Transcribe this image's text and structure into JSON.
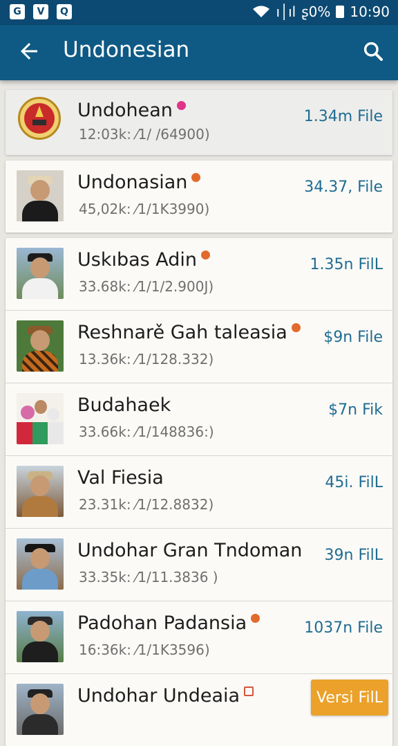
{
  "status_bar": {
    "left_icons": [
      "G",
      "V",
      "Q"
    ],
    "signal_text": "ı│ıl",
    "battery_text": "ʂ0%",
    "time": "10:90"
  },
  "app_bar": {
    "title": "Undonesian",
    "back_icon": "arrow-left-icon",
    "search_icon": "search-icon"
  },
  "items": [
    {
      "title": "Undohean",
      "subtitle": "12:03k: ⁄1/ /64900)",
      "size": "1.34m File",
      "badge": "pink"
    },
    {
      "title": "Undonasian",
      "subtitle": "45,02k: ⁄1/1K3990)",
      "size": "34.37, File",
      "badge": "orange"
    },
    {
      "title": "Uskıbas Adin",
      "subtitle": "33.68k: ⁄1/1/2.900J)",
      "size": "1.35n FilL",
      "badge": "orange"
    },
    {
      "title": "Reshnarě Gah taleasia",
      "subtitle": "13.36k: ⁄1/128.332)",
      "size": "$9n File",
      "badge": "orange"
    },
    {
      "title": "Budahaek",
      "subtitle": "33.66k: ⁄1/148836:)",
      "size": "$7n Fik",
      "badge": ""
    },
    {
      "title": "Val Fiesia",
      "subtitle": "23.31k: ⁄1/12.8832)",
      "size": "45i. FilL",
      "badge": ""
    },
    {
      "title": "Undohar Gran Tndoman",
      "subtitle": "33.35k: ⁄1/11.3836 )",
      "size": "39n FilL",
      "badge": ""
    },
    {
      "title": "Padohan Padansia",
      "subtitle": "16:36k: ⁄1/1K3596)",
      "size": "1037n File",
      "badge": "orange"
    },
    {
      "title": "Undohar Undeaia",
      "subtitle": "",
      "size": "",
      "badge": "outline",
      "action": "Versi FilL"
    }
  ],
  "colors": {
    "app_bar": "#0f5a85",
    "status_bar": "#0d4a73",
    "accent_size": "#1f6c92",
    "action_button": "#eba12a"
  }
}
